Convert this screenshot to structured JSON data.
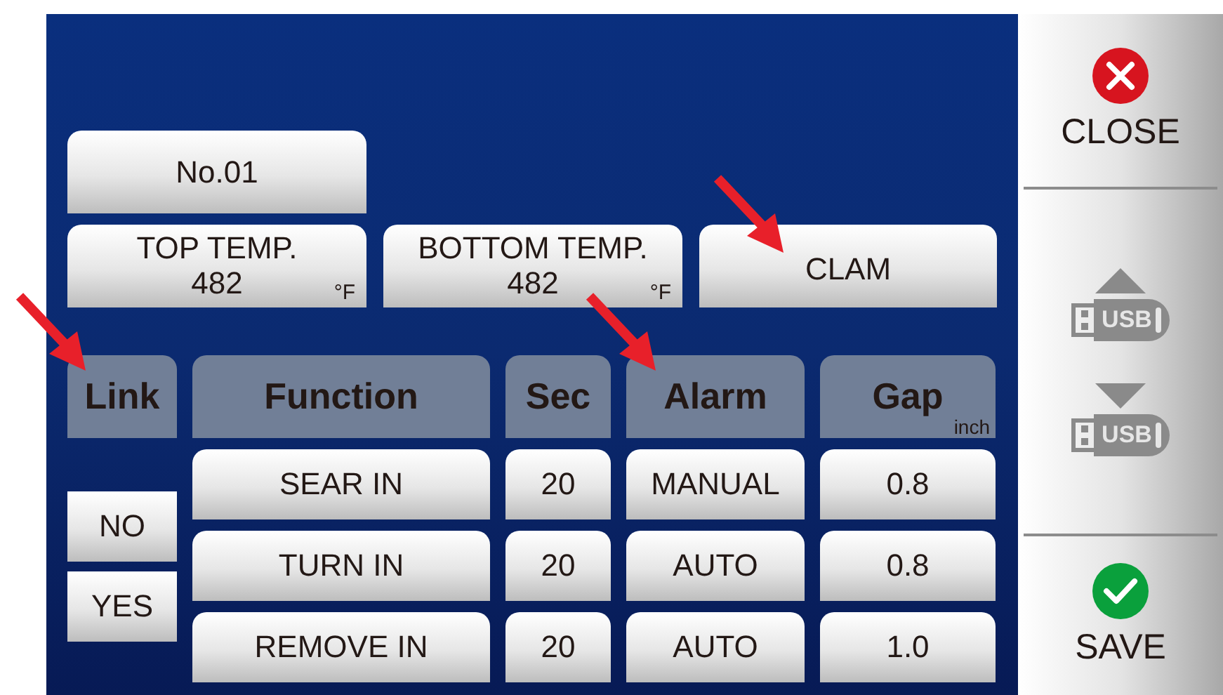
{
  "program": {
    "label": "No.01"
  },
  "settings": [
    {
      "label": "TOP TEMP.",
      "value": "482",
      "unit": "°F"
    },
    {
      "label": "BOTTOM TEMP.",
      "value": "482",
      "unit": "°F"
    }
  ],
  "mode": {
    "label": "CLAM"
  },
  "table": {
    "columns": [
      {
        "label": "Link"
      },
      {
        "label": "Function"
      },
      {
        "label": "Sec"
      },
      {
        "label": "Alarm"
      },
      {
        "label": "Gap",
        "unit": "inch"
      }
    ],
    "rows": [
      {
        "function": "SEAR IN",
        "sec": "20",
        "alarm": "MANUAL",
        "gap": "0.8"
      },
      {
        "function": "TURN IN",
        "sec": "20",
        "alarm": "AUTO",
        "gap": "0.8"
      },
      {
        "function": "REMOVE IN",
        "sec": "20",
        "alarm": "AUTO",
        "gap": "1.0"
      }
    ]
  },
  "link_options": [
    "NO",
    "YES"
  ],
  "sidebar": {
    "buttons": [
      {
        "kind": "close",
        "label": "CLOSE"
      },
      {
        "kind": "usb_upload",
        "label": "USB"
      },
      {
        "kind": "usb_download",
        "label": "USB"
      },
      {
        "kind": "save",
        "label": "SAVE"
      }
    ]
  }
}
